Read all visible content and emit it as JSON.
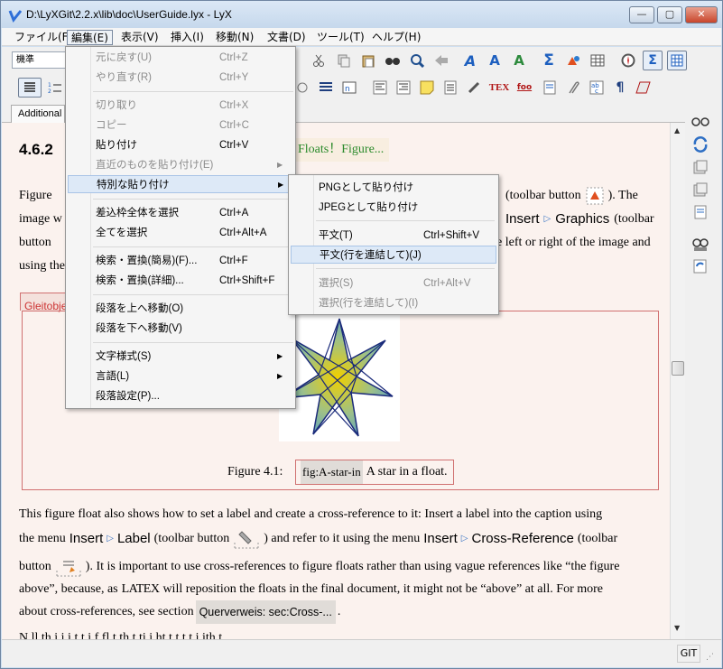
{
  "window": {
    "title": "D:\\LyXGit\\2.2.x\\lib\\doc\\UserGuide.lyx - LyX",
    "minimize": "—",
    "maximize": "▢",
    "close": "✕"
  },
  "menubar": [
    {
      "label": "ファイル(F)"
    },
    {
      "label": "編集(E)"
    },
    {
      "label": "表示(V)"
    },
    {
      "label": "挿入(I)"
    },
    {
      "label": "移動(N)"
    },
    {
      "label": "文書(D)"
    },
    {
      "label": "ツール(T)"
    },
    {
      "label": "ヘルプ(H)"
    }
  ],
  "toolbar": {
    "style_combo": "機準",
    "tab_label": "Additional"
  },
  "edit_menu": {
    "items": [
      {
        "label": "元に戻す(U)",
        "shortcut": "Ctrl+Z"
      },
      {
        "label": "やり直す(R)",
        "shortcut": "Ctrl+Y"
      },
      {
        "label": "切り取り",
        "shortcut": "Ctrl+X"
      },
      {
        "label": "コピー",
        "shortcut": "Ctrl+C"
      },
      {
        "label": "貼り付け",
        "shortcut": "Ctrl+V"
      },
      {
        "label": "直近のものを貼り付け(E)",
        "shortcut": ""
      },
      {
        "label": "特別な貼り付け",
        "shortcut": ""
      },
      {
        "label": "差込枠全体を選択",
        "shortcut": "Ctrl+A"
      },
      {
        "label": "全てを選択",
        "shortcut": "Ctrl+Alt+A"
      },
      {
        "label": "検索・置換(簡易)(F)...",
        "shortcut": "Ctrl+F"
      },
      {
        "label": "検索・置換(詳細)...",
        "shortcut": "Ctrl+Shift+F"
      },
      {
        "label": "段落を上へ移動(O)",
        "shortcut": ""
      },
      {
        "label": "段落を下へ移動(V)",
        "shortcut": ""
      },
      {
        "label": "文字様式(S)",
        "shortcut": ""
      },
      {
        "label": "言語(L)",
        "shortcut": ""
      },
      {
        "label": "段落設定(P)...",
        "shortcut": ""
      }
    ]
  },
  "paste_special_menu": {
    "items": [
      {
        "label": "PNGとして貼り付け",
        "shortcut": ""
      },
      {
        "label": "JPEGとして貼り付け",
        "shortcut": ""
      },
      {
        "label": "平文(T)",
        "shortcut": "Ctrl+Shift+V"
      },
      {
        "label": "平文(行を連結して)(J)",
        "shortcut": ""
      },
      {
        "label": "選択(S)",
        "shortcut": "Ctrl+Alt+V"
      },
      {
        "label": "選択(行を連結して)(I)",
        "shortcut": ""
      }
    ]
  },
  "document": {
    "section_number": "4.6.2",
    "section_ref": "Floats！Figure...",
    "p1_a": "Figure",
    "p1_b": "(toolbar button",
    "p1_c": "). The",
    "p2_a": "image w",
    "p2_insert": "Insert",
    "p2_graphics": "Graphics",
    "p2_b": "(toolbar",
    "p3_a": "button",
    "p3_b": "e left or right of the image and",
    "p4_a": "using the",
    "float_label": "Gleitobje",
    "caption_prefix": "Figure 4.1:",
    "caption_label": "fig:A-star-in",
    "caption_text": "A star in a float.",
    "para2_l1": "This figure float also shows how to set a label and create a cross-reference to it: Insert a label into the caption using",
    "para2_l2a": "the menu",
    "para2_insert1": "Insert",
    "para2_label": "Label",
    "para2_l2b": "(toolbar button",
    "para2_l2c": ") and refer to it using the menu",
    "para2_insert2": "Insert",
    "para2_crossref": "Cross-Reference",
    "para2_l2d": "(toolbar",
    "para2_l3a": "button",
    "para2_l3b": "). It is important to use cross-references to figure floats rather than using vague references like “the figure",
    "para2_l4a": "above”, because, as",
    "para2_latex": "LATEX",
    "para2_l4b": "will reposition the floats in the final document, it might not be “above” at all. For more",
    "para2_l5a": "about cross-references, see section",
    "para2_xref": "Querverweis: sec:Cross-...",
    "para2_l5b": ".",
    "para3_partial": "N         ll      th           i    i i   t  t      i   f  fl   t  th    t       ti                    i  ht      t t    t     t     i      ith    t"
  },
  "status": {
    "git": "GIT"
  }
}
